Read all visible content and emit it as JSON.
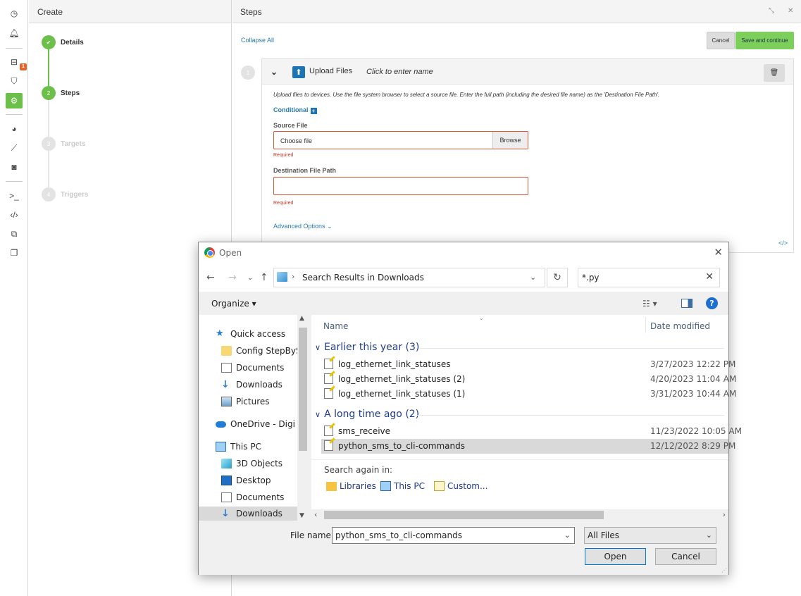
{
  "create": {
    "title": "Create",
    "steps": [
      {
        "num": "",
        "label": "Details"
      },
      {
        "num": "2",
        "label": "Steps"
      },
      {
        "num": "3",
        "label": "Targets"
      },
      {
        "num": "4",
        "label": "Triggers"
      }
    ]
  },
  "rail": {
    "badge": "1"
  },
  "steps": {
    "title": "Steps",
    "collapse_all": "Collapse All",
    "cancel": "Cancel",
    "save": "Save and continue",
    "step_number": "1",
    "card": {
      "title": "Upload Files",
      "name_placeholder": "Click to enter name",
      "description": "Upload files to devices. Use the file system browser to select a source file. Enter the full path (including the desired file name) as the 'Destination File Path'.",
      "conditional": "Conditional",
      "source_label": "Source File",
      "choose_file": "Choose file",
      "browse": "Browse",
      "required": "Required",
      "dest_label": "Destination File Path",
      "advanced": "Advanced Options",
      "code_icon": "</>"
    }
  },
  "dialog": {
    "title": "Open",
    "address": "Search Results in Downloads",
    "search_value": "*.py",
    "organize": "Organize",
    "nav": [
      {
        "label": "Quick access",
        "icon": "star-icon"
      },
      {
        "label": "Config StepBySt",
        "icon": "folder-icon"
      },
      {
        "label": "Documents",
        "icon": "documents-icon"
      },
      {
        "label": "Downloads",
        "icon": "download-icon"
      },
      {
        "label": "Pictures",
        "icon": "pictures-icon"
      },
      {
        "label": "OneDrive - Digi In",
        "icon": "cloud-icon"
      },
      {
        "label": "This PC",
        "icon": "computer-icon"
      },
      {
        "label": "3D Objects",
        "icon": "cube-icon"
      },
      {
        "label": "Desktop",
        "icon": "desktop-icon"
      },
      {
        "label": "Documents",
        "icon": "documents-icon"
      },
      {
        "label": "Downloads",
        "icon": "download-icon"
      }
    ],
    "columns": {
      "name": "Name",
      "date": "Date modified"
    },
    "groups": [
      {
        "label": "Earlier this year (3)",
        "files": [
          {
            "name": "log_ethernet_link_statuses",
            "date": "3/27/2023 12:22 PM"
          },
          {
            "name": "log_ethernet_link_statuses (2)",
            "date": "4/20/2023 11:04 AM"
          },
          {
            "name": "log_ethernet_link_statuses (1)",
            "date": "3/31/2023 10:44 AM"
          }
        ]
      },
      {
        "label": "A long time ago (2)",
        "files": [
          {
            "name": "sms_receive",
            "date": "11/23/2022 10:05 AM"
          },
          {
            "name": "python_sms_to_cli-commands",
            "date": "12/12/2022 8:29 PM"
          }
        ]
      }
    ],
    "search_again": "Search again in:",
    "search_links": [
      "Libraries",
      "This PC",
      "Custom..."
    ],
    "file_name_label": "File name:",
    "file_name": "python_sms_to_cli-commands",
    "file_type": "All Files",
    "open": "Open",
    "cancel": "Cancel"
  },
  "colors": {
    "accent_green": "#6cc04a",
    "link_blue": "#2a7ab0",
    "error_red": "#d0573a"
  }
}
